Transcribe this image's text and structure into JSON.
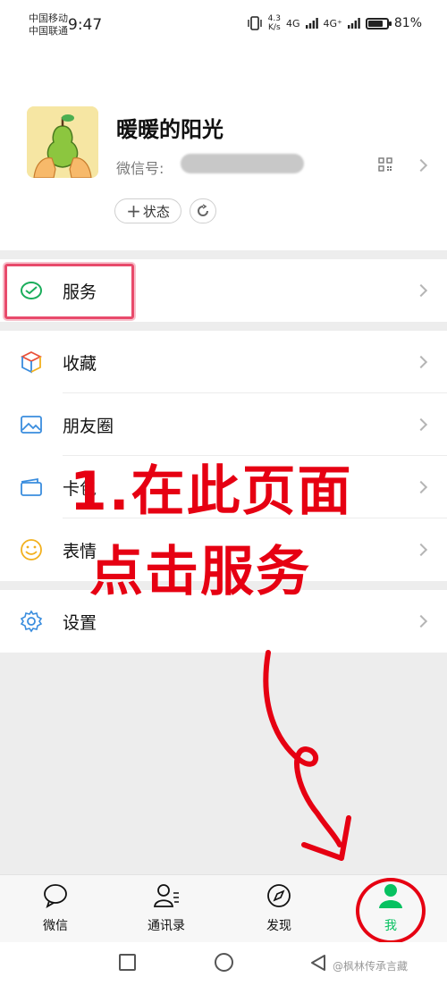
{
  "status_bar": {
    "carrier_1": "中国移动",
    "carrier_2": "中国联通",
    "time": "9:47",
    "net_speed_value": "4.3",
    "net_speed_unit": "K/s",
    "signal_1": "4G",
    "signal_2": "4G⁺",
    "battery": "81%"
  },
  "profile": {
    "nickname": "暖暖的阳光",
    "wxid_label": "微信号:",
    "status_button": "状态",
    "status_plus": "+"
  },
  "menu": {
    "service": "服务",
    "favorites": "收藏",
    "moments": "朋友圈",
    "cards": "卡包",
    "stickers": "表情",
    "settings": "设置"
  },
  "annotation": {
    "line1": "1.在此页面",
    "line2": "点击服务"
  },
  "tabs": [
    {
      "label": "微信",
      "icon": "chat-icon"
    },
    {
      "label": "通讯录",
      "icon": "contacts-icon"
    },
    {
      "label": "发现",
      "icon": "compass-icon"
    },
    {
      "label": "我",
      "icon": "person-icon"
    }
  ],
  "watermark": "@枫林传承言藏",
  "colors": {
    "accent_green": "#07c160",
    "annotation_red": "#e60012",
    "highlight_pink": "#e84a6b"
  }
}
